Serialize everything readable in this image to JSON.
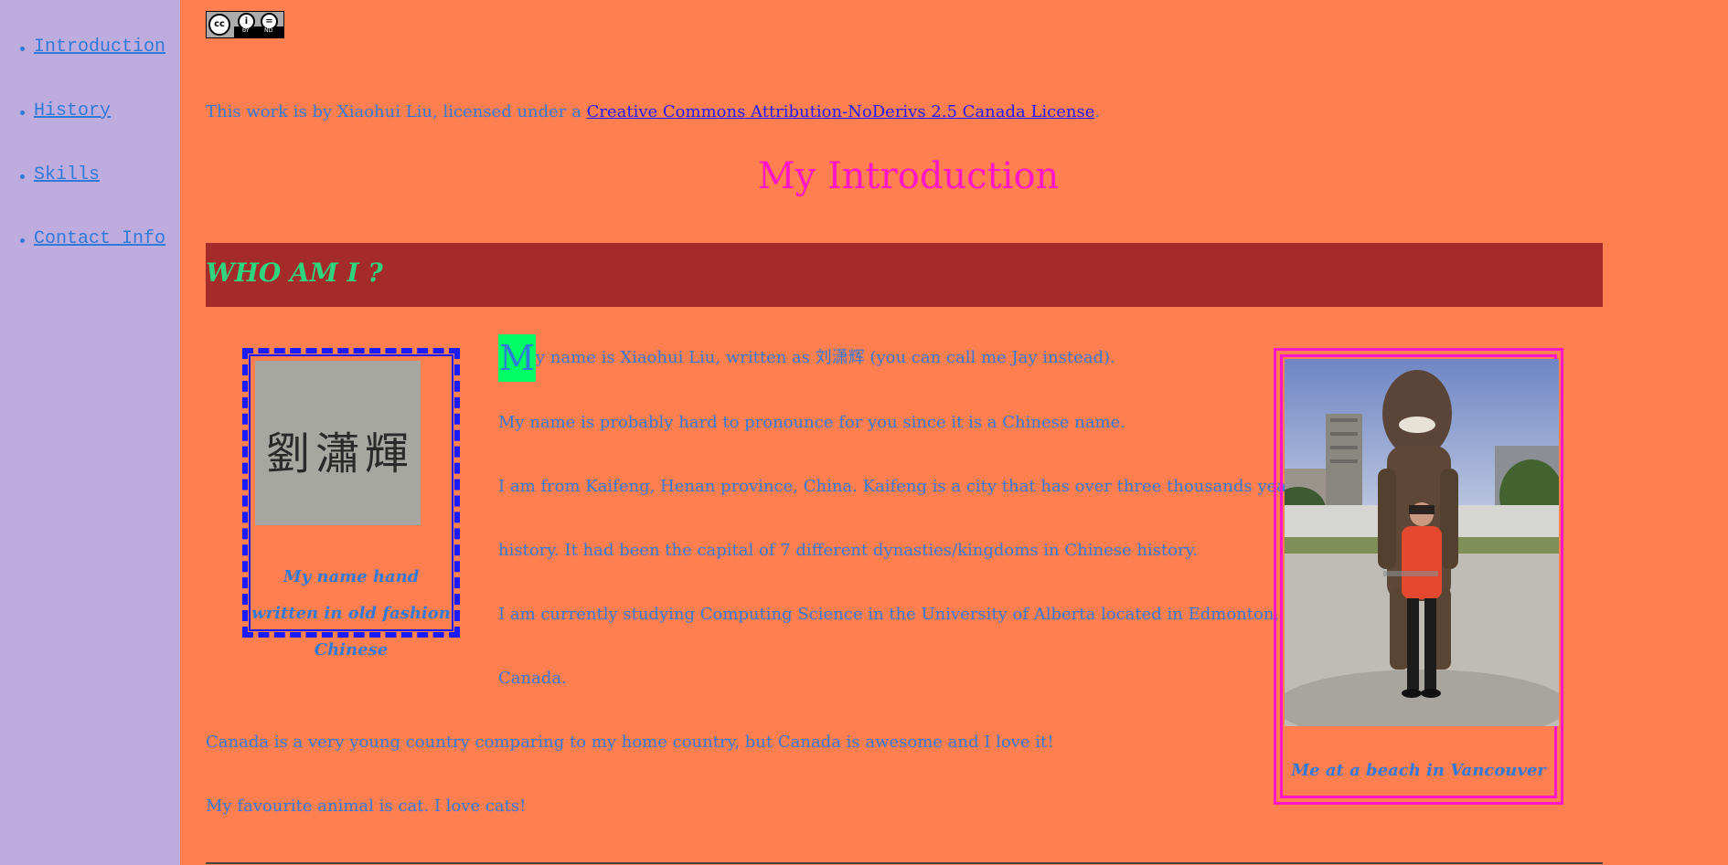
{
  "sidebar": {
    "items": [
      {
        "label": "Introduction"
      },
      {
        "label": "History"
      },
      {
        "label": "Skills"
      },
      {
        "label": "Contact Info"
      }
    ]
  },
  "license": {
    "badge_cc": "cc",
    "badge_by": "BY",
    "badge_nd": "ND",
    "prefix": "This work is by Xiaohui Liu, licensed under a ",
    "link_text": "Creative Commons Attribution-NoDerivs 2.5 Canada License",
    "suffix": "."
  },
  "page_title": "My Introduction",
  "section": {
    "heading": "WHO AM I ?"
  },
  "figure_left": {
    "handwriting": "劉瀟輝",
    "caption": "My name hand written in old fashion Chinese"
  },
  "intro": {
    "dropcap": "M",
    "p1_rest": "y name is Xiaohui Liu, written as 刘潇辉 (you can call me Jay instead).",
    "p2": "My name is probably hard to pronounce for you since it is a Chinese name.",
    "p3_line1": "I am from Kaifeng, Henan province, China. Kaifeng is a city that has over three thousands years",
    "p3_line2": "history. It had been the capital of 7 different dynasties/kingdoms in Chinese history.",
    "p4_line1": "I am currently studying Computing Science in the University of Alberta located in Edmonton,",
    "p4_line2": "Canada.",
    "p5": "Canada is a very young country comparing to my home country, but Canada is awesome and I love it!",
    "p6": "My favourite animal is cat. I love cats!"
  },
  "figure_right": {
    "caption": "Me at a beach in Vancouver"
  },
  "colors": {
    "page_bg": "#ff7f50",
    "sidebar_bg": "#bfacdf",
    "text": "#2f7ad8",
    "title": "#ff14c8",
    "section_bg": "#a52a2a",
    "section_text": "#2ed57e",
    "dropcap_bg": "#00ff66",
    "left_border": "#1a1aff",
    "right_border": "#ff14c8"
  }
}
